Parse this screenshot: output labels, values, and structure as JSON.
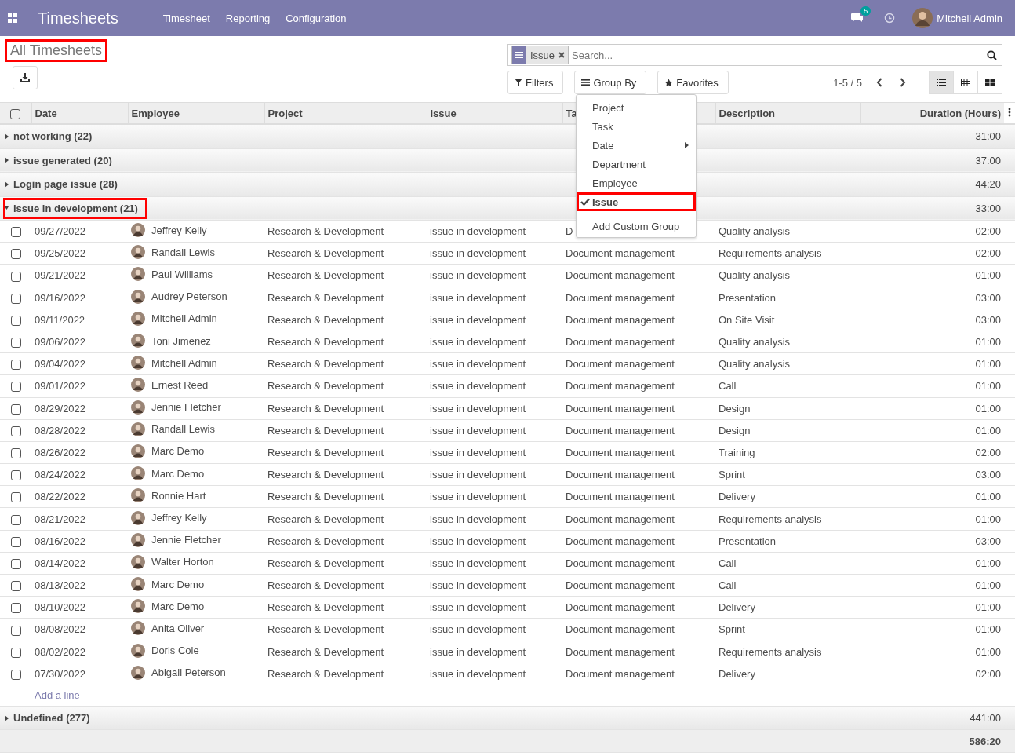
{
  "navbar": {
    "app_title": "Timesheets",
    "menu": [
      "Timesheet",
      "Reporting",
      "Configuration"
    ],
    "messages_badge": "5",
    "user": "Mitchell Admin"
  },
  "breadcrumb": {
    "title": "All Timesheets",
    "highlighted": true
  },
  "search": {
    "facet": "Issue",
    "placeholder": "Search..."
  },
  "filter_buttons": [
    "Filters",
    "Group By",
    "Favorites"
  ],
  "pager": "1-5 / 5",
  "views": [
    {
      "kind": "list",
      "selected": true
    },
    {
      "kind": "grid",
      "selected": false
    },
    {
      "kind": "kanban",
      "selected": false
    }
  ],
  "group_by_menu": [
    {
      "label": "Project",
      "kind": "option",
      "checked": false,
      "highlighted": false
    },
    {
      "label": "Task",
      "kind": "option",
      "checked": false,
      "highlighted": false
    },
    {
      "label": "Date",
      "kind": "submenu",
      "checked": false,
      "highlighted": false
    },
    {
      "label": "Department",
      "kind": "option",
      "checked": false,
      "highlighted": false
    },
    {
      "label": "Employee",
      "kind": "option",
      "checked": false,
      "highlighted": false
    },
    {
      "label": "Issue",
      "kind": "option",
      "checked": true,
      "highlighted": true
    },
    {
      "label": "Add Custom Group",
      "kind": "custom",
      "checked": false,
      "highlighted": false
    }
  ],
  "table": {
    "select_all_checked": false,
    "columns": [
      "Date",
      "Employee",
      "Project",
      "Issue",
      "Ta",
      "Description",
      "Duration (Hours)"
    ],
    "groups": [
      {
        "label": "not working (22)",
        "total": "31:00",
        "expanded": false,
        "highlighted": false
      },
      {
        "label": "issue generated (20)",
        "total": "37:00",
        "expanded": false,
        "highlighted": false
      },
      {
        "label": "Login page issue (28)",
        "total": "44:20",
        "expanded": false,
        "highlighted": false
      },
      {
        "label": "issue in development (21)",
        "total": "33:00",
        "expanded": true,
        "highlighted": true,
        "rows": [
          {
            "date": "09/27/2022",
            "employee": "Jeffrey Kelly",
            "project": "Research & Development",
            "issue": "issue in development",
            "task": "D",
            "description": "Quality analysis",
            "duration": "02:00",
            "checked": false
          },
          {
            "date": "09/25/2022",
            "employee": "Randall Lewis",
            "project": "Research & Development",
            "issue": "issue in development",
            "task": "Document management",
            "description": "Requirements analysis",
            "duration": "02:00",
            "checked": false
          },
          {
            "date": "09/21/2022",
            "employee": "Paul Williams",
            "project": "Research & Development",
            "issue": "issue in development",
            "task": "Document management",
            "description": "Quality analysis",
            "duration": "01:00",
            "checked": false
          },
          {
            "date": "09/16/2022",
            "employee": "Audrey Peterson",
            "project": "Research & Development",
            "issue": "issue in development",
            "task": "Document management",
            "description": "Presentation",
            "duration": "03:00",
            "checked": false
          },
          {
            "date": "09/11/2022",
            "employee": "Mitchell Admin",
            "project": "Research & Development",
            "issue": "issue in development",
            "task": "Document management",
            "description": "On Site Visit",
            "duration": "03:00",
            "checked": false
          },
          {
            "date": "09/06/2022",
            "employee": "Toni Jimenez",
            "project": "Research & Development",
            "issue": "issue in development",
            "task": "Document management",
            "description": "Quality analysis",
            "duration": "01:00",
            "checked": false
          },
          {
            "date": "09/04/2022",
            "employee": "Mitchell Admin",
            "project": "Research & Development",
            "issue": "issue in development",
            "task": "Document management",
            "description": "Quality analysis",
            "duration": "01:00",
            "checked": false
          },
          {
            "date": "09/01/2022",
            "employee": "Ernest Reed",
            "project": "Research & Development",
            "issue": "issue in development",
            "task": "Document management",
            "description": "Call",
            "duration": "01:00",
            "checked": false
          },
          {
            "date": "08/29/2022",
            "employee": "Jennie Fletcher",
            "project": "Research & Development",
            "issue": "issue in development",
            "task": "Document management",
            "description": "Design",
            "duration": "01:00",
            "checked": false
          },
          {
            "date": "08/28/2022",
            "employee": "Randall Lewis",
            "project": "Research & Development",
            "issue": "issue in development",
            "task": "Document management",
            "description": "Design",
            "duration": "01:00",
            "checked": false
          },
          {
            "date": "08/26/2022",
            "employee": "Marc Demo",
            "project": "Research & Development",
            "issue": "issue in development",
            "task": "Document management",
            "description": "Training",
            "duration": "02:00",
            "checked": false
          },
          {
            "date": "08/24/2022",
            "employee": "Marc Demo",
            "project": "Research & Development",
            "issue": "issue in development",
            "task": "Document management",
            "description": "Sprint",
            "duration": "03:00",
            "checked": false
          },
          {
            "date": "08/22/2022",
            "employee": "Ronnie Hart",
            "project": "Research & Development",
            "issue": "issue in development",
            "task": "Document management",
            "description": "Delivery",
            "duration": "01:00",
            "checked": false
          },
          {
            "date": "08/21/2022",
            "employee": "Jeffrey Kelly",
            "project": "Research & Development",
            "issue": "issue in development",
            "task": "Document management",
            "description": "Requirements analysis",
            "duration": "01:00",
            "checked": false
          },
          {
            "date": "08/16/2022",
            "employee": "Jennie Fletcher",
            "project": "Research & Development",
            "issue": "issue in development",
            "task": "Document management",
            "description": "Presentation",
            "duration": "03:00",
            "checked": false
          },
          {
            "date": "08/14/2022",
            "employee": "Walter Horton",
            "project": "Research & Development",
            "issue": "issue in development",
            "task": "Document management",
            "description": "Call",
            "duration": "01:00",
            "checked": false
          },
          {
            "date": "08/13/2022",
            "employee": "Marc Demo",
            "project": "Research & Development",
            "issue": "issue in development",
            "task": "Document management",
            "description": "Call",
            "duration": "01:00",
            "checked": false
          },
          {
            "date": "08/10/2022",
            "employee": "Marc Demo",
            "project": "Research & Development",
            "issue": "issue in development",
            "task": "Document management",
            "description": "Delivery",
            "duration": "01:00",
            "checked": false
          },
          {
            "date": "08/08/2022",
            "employee": "Anita Oliver",
            "project": "Research & Development",
            "issue": "issue in development",
            "task": "Document management",
            "description": "Sprint",
            "duration": "01:00",
            "checked": false
          },
          {
            "date": "08/02/2022",
            "employee": "Doris Cole",
            "project": "Research & Development",
            "issue": "issue in development",
            "task": "Document management",
            "description": "Requirements analysis",
            "duration": "01:00",
            "checked": false
          },
          {
            "date": "07/30/2022",
            "employee": "Abigail Peterson",
            "project": "Research & Development",
            "issue": "issue in development",
            "task": "Document management",
            "description": "Delivery",
            "duration": "02:00",
            "checked": false
          }
        ],
        "add_line": "Add a line"
      },
      {
        "label": "Undefined (277)",
        "total": "441:00",
        "expanded": false,
        "highlighted": false
      }
    ],
    "grand_total": "586:20"
  }
}
